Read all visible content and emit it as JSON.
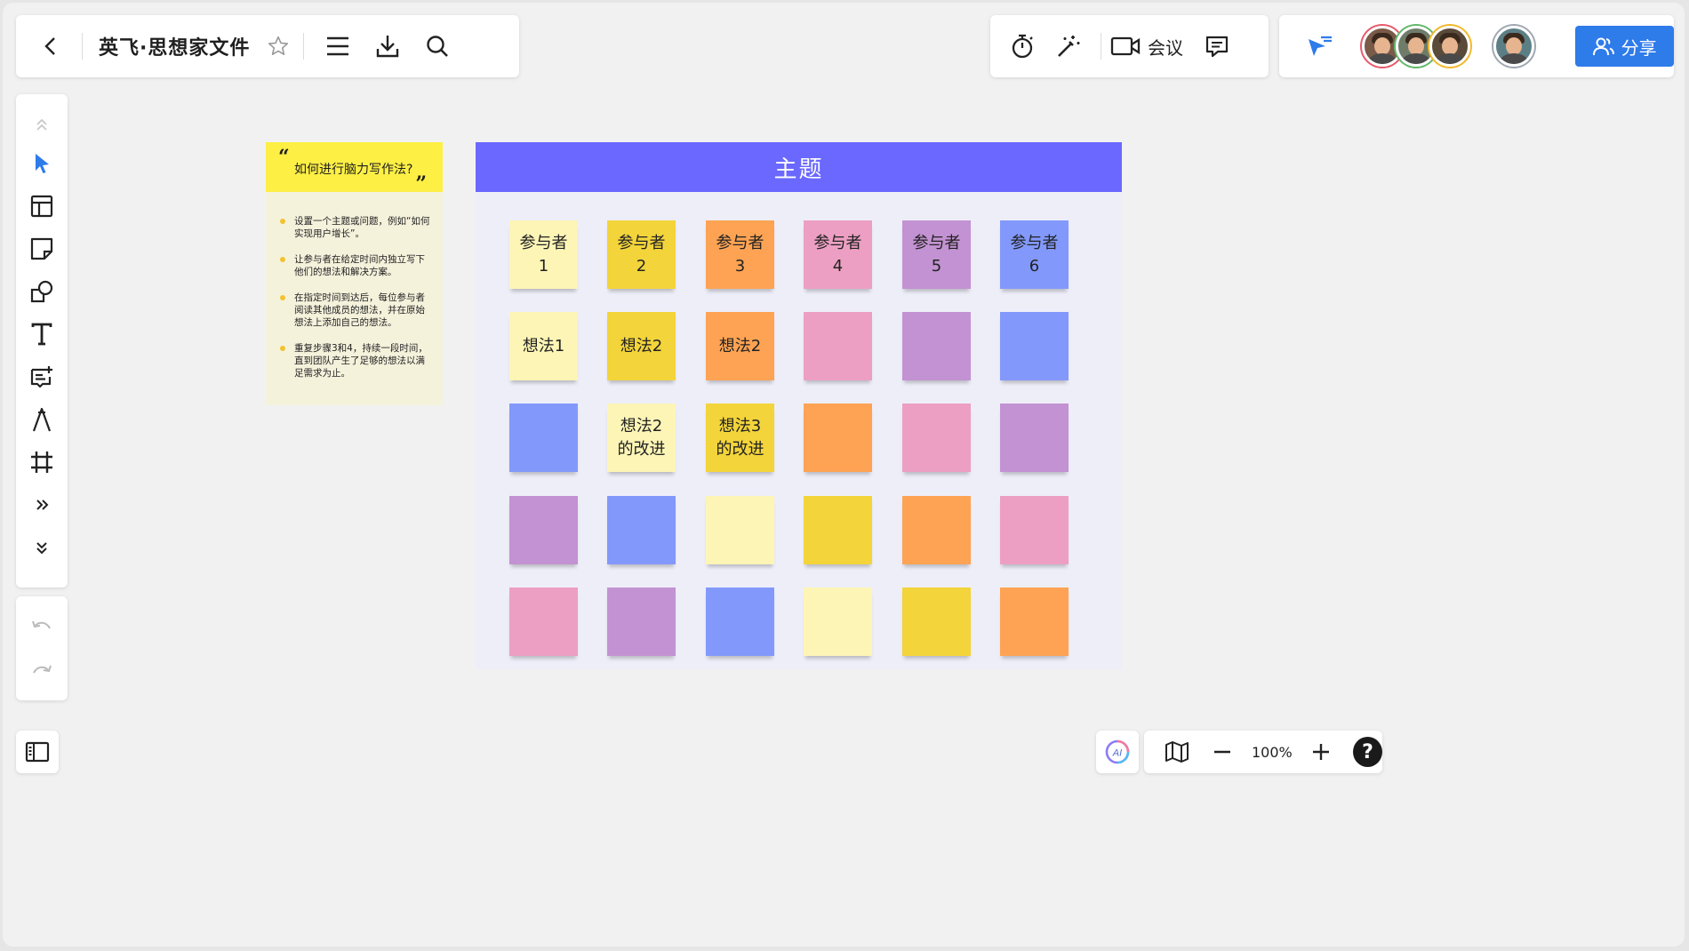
{
  "header": {
    "doc_title": "英飞·思想家文件",
    "meeting_label": "会议",
    "share_label": "分享"
  },
  "colors": {
    "accent": "#2e7bea",
    "board_header": "#6a68fe",
    "light_yellow": "#fdf5b6",
    "yellow": "#f3d43a",
    "orange": "#fda353",
    "pink": "#ec9fc2",
    "purple": "#c392d2",
    "blue": "#8299fb"
  },
  "collaborators": [
    {
      "name": "avatar-1",
      "ring": "#e75a6b",
      "bg": "#7a5a48"
    },
    {
      "name": "avatar-2",
      "ring": "#62b86b",
      "bg": "#6f7c6a"
    },
    {
      "name": "avatar-3",
      "ring": "#f2b92c",
      "bg": "#5a4a3a"
    },
    {
      "name": "avatar-4",
      "ring": "#9fa8b2",
      "bg": "#5c7f86"
    }
  ],
  "instructions": {
    "question": "如何进行脑力写作法?",
    "open_quote": "“",
    "close_quote": "”",
    "steps": [
      "设置一个主题或问题，例如“如何实现用户增长”。",
      "让参与者在给定时间内独立写下他们的想法和解决方案。",
      "在指定时间到达后，每位参与者阅读其他成员的想法，并在原始想法上添加自己的想法。",
      "重复步骤3和4，持续一段时间，直到团队产生了足够的想法以满足需求为止。"
    ]
  },
  "board": {
    "title": "主题",
    "rows": [
      [
        {
          "text": "参与者\n1",
          "color": "#fdf5b6"
        },
        {
          "text": "参与者\n2",
          "color": "#f3d43a"
        },
        {
          "text": "参与者\n3",
          "color": "#fda353"
        },
        {
          "text": "参与者\n4",
          "color": "#ec9fc2"
        },
        {
          "text": "参与者\n5",
          "color": "#c392d2"
        },
        {
          "text": "参与者\n6",
          "color": "#8299fb"
        }
      ],
      [
        {
          "text": "想法1",
          "color": "#fdf5b6"
        },
        {
          "text": "想法2",
          "color": "#f3d43a"
        },
        {
          "text": "想法2",
          "color": "#fda353"
        },
        {
          "text": "",
          "color": "#ec9fc2"
        },
        {
          "text": "",
          "color": "#c392d2"
        },
        {
          "text": "",
          "color": "#8299fb"
        }
      ],
      [
        {
          "text": "",
          "color": "#8299fb"
        },
        {
          "text": "想法2\n的改进",
          "color": "#fdf5b6"
        },
        {
          "text": "想法3\n的改进",
          "color": "#f3d43a"
        },
        {
          "text": "",
          "color": "#fda353"
        },
        {
          "text": "",
          "color": "#ec9fc2"
        },
        {
          "text": "",
          "color": "#c392d2"
        }
      ],
      [
        {
          "text": "",
          "color": "#c392d2"
        },
        {
          "text": "",
          "color": "#8299fb"
        },
        {
          "text": "",
          "color": "#fdf5b6"
        },
        {
          "text": "",
          "color": "#f3d43a"
        },
        {
          "text": "",
          "color": "#fda353"
        },
        {
          "text": "",
          "color": "#ec9fc2"
        }
      ],
      [
        {
          "text": "",
          "color": "#ec9fc2"
        },
        {
          "text": "",
          "color": "#c392d2"
        },
        {
          "text": "",
          "color": "#8299fb"
        },
        {
          "text": "",
          "color": "#fdf5b6"
        },
        {
          "text": "",
          "color": "#f3d43a"
        },
        {
          "text": "",
          "color": "#fda353"
        }
      ]
    ]
  },
  "zoom": {
    "level": "100%",
    "help": "?"
  }
}
